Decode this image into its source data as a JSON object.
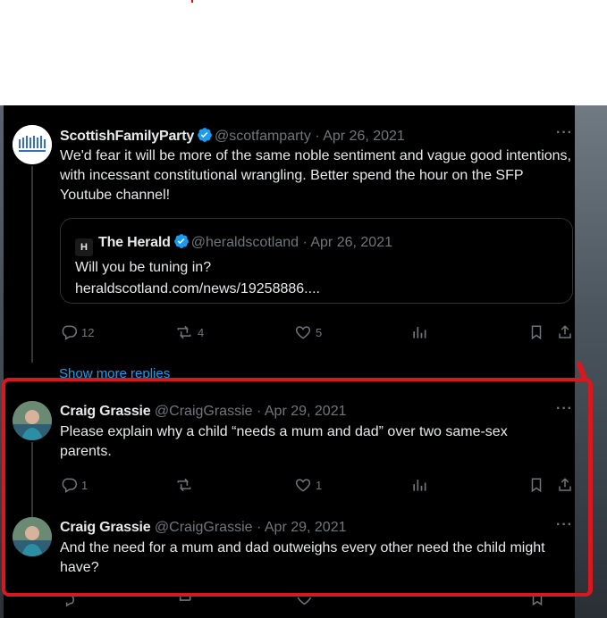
{
  "colors": {
    "background": "#000000",
    "text": "#e7e9ea",
    "muted": "#71767b",
    "verified": "#1d9bf0",
    "annotation": "#d7191f"
  },
  "tweets": [
    {
      "name": "ScottishFamilyParty",
      "handle": "@scotfamparty",
      "date": "· Apr 26, 2021",
      "verified": true,
      "text": "We'd fear it will be more of the same noble sentiment and vague good intentions, with incessant constitutional wrangling.  Better spend the hour on the SFP Youtube channel!",
      "quote": {
        "name": "The Herald",
        "handle": "@heraldscotland",
        "date": "· Apr 26, 2021",
        "logo": "H",
        "text": "Will you be tuning in?",
        "link": "heraldscotland.com/news/19258886...."
      },
      "actions": {
        "replies": "12",
        "retweets": "4",
        "likes": "5"
      },
      "more": "···"
    },
    {
      "name": "Craig Grassie",
      "handle": "@CraigGrassie",
      "date": "· Apr 29, 2021",
      "text": "Please explain why a child “needs a mum and dad” over two same-sex parents.",
      "actions": {
        "replies": "1",
        "retweets": "",
        "likes": "1"
      },
      "more": "···"
    },
    {
      "name": "Craig Grassie",
      "handle": "@CraigGrassie",
      "date": "· Apr 29, 2021",
      "text": "And the need for a mum and dad outweighs every other need the child might have?",
      "more": "···"
    }
  ],
  "show_more": "Show more replies"
}
